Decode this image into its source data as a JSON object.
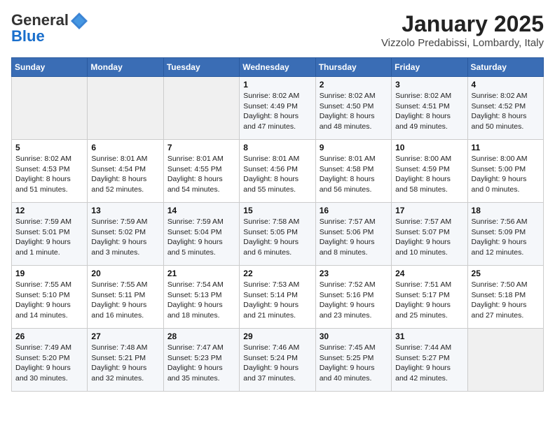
{
  "header": {
    "logo_line1": "General",
    "logo_line2": "Blue",
    "title": "January 2025",
    "subtitle": "Vizzolo Predabissi, Lombardy, Italy"
  },
  "weekdays": [
    "Sunday",
    "Monday",
    "Tuesday",
    "Wednesday",
    "Thursday",
    "Friday",
    "Saturday"
  ],
  "weeks": [
    [
      {
        "day": "",
        "info": ""
      },
      {
        "day": "",
        "info": ""
      },
      {
        "day": "",
        "info": ""
      },
      {
        "day": "1",
        "info": "Sunrise: 8:02 AM\nSunset: 4:49 PM\nDaylight: 8 hours and 47 minutes."
      },
      {
        "day": "2",
        "info": "Sunrise: 8:02 AM\nSunset: 4:50 PM\nDaylight: 8 hours and 48 minutes."
      },
      {
        "day": "3",
        "info": "Sunrise: 8:02 AM\nSunset: 4:51 PM\nDaylight: 8 hours and 49 minutes."
      },
      {
        "day": "4",
        "info": "Sunrise: 8:02 AM\nSunset: 4:52 PM\nDaylight: 8 hours and 50 minutes."
      }
    ],
    [
      {
        "day": "5",
        "info": "Sunrise: 8:02 AM\nSunset: 4:53 PM\nDaylight: 8 hours and 51 minutes."
      },
      {
        "day": "6",
        "info": "Sunrise: 8:01 AM\nSunset: 4:54 PM\nDaylight: 8 hours and 52 minutes."
      },
      {
        "day": "7",
        "info": "Sunrise: 8:01 AM\nSunset: 4:55 PM\nDaylight: 8 hours and 54 minutes."
      },
      {
        "day": "8",
        "info": "Sunrise: 8:01 AM\nSunset: 4:56 PM\nDaylight: 8 hours and 55 minutes."
      },
      {
        "day": "9",
        "info": "Sunrise: 8:01 AM\nSunset: 4:58 PM\nDaylight: 8 hours and 56 minutes."
      },
      {
        "day": "10",
        "info": "Sunrise: 8:00 AM\nSunset: 4:59 PM\nDaylight: 8 hours and 58 minutes."
      },
      {
        "day": "11",
        "info": "Sunrise: 8:00 AM\nSunset: 5:00 PM\nDaylight: 9 hours and 0 minutes."
      }
    ],
    [
      {
        "day": "12",
        "info": "Sunrise: 7:59 AM\nSunset: 5:01 PM\nDaylight: 9 hours and 1 minute."
      },
      {
        "day": "13",
        "info": "Sunrise: 7:59 AM\nSunset: 5:02 PM\nDaylight: 9 hours and 3 minutes."
      },
      {
        "day": "14",
        "info": "Sunrise: 7:59 AM\nSunset: 5:04 PM\nDaylight: 9 hours and 5 minutes."
      },
      {
        "day": "15",
        "info": "Sunrise: 7:58 AM\nSunset: 5:05 PM\nDaylight: 9 hours and 6 minutes."
      },
      {
        "day": "16",
        "info": "Sunrise: 7:57 AM\nSunset: 5:06 PM\nDaylight: 9 hours and 8 minutes."
      },
      {
        "day": "17",
        "info": "Sunrise: 7:57 AM\nSunset: 5:07 PM\nDaylight: 9 hours and 10 minutes."
      },
      {
        "day": "18",
        "info": "Sunrise: 7:56 AM\nSunset: 5:09 PM\nDaylight: 9 hours and 12 minutes."
      }
    ],
    [
      {
        "day": "19",
        "info": "Sunrise: 7:55 AM\nSunset: 5:10 PM\nDaylight: 9 hours and 14 minutes."
      },
      {
        "day": "20",
        "info": "Sunrise: 7:55 AM\nSunset: 5:11 PM\nDaylight: 9 hours and 16 minutes."
      },
      {
        "day": "21",
        "info": "Sunrise: 7:54 AM\nSunset: 5:13 PM\nDaylight: 9 hours and 18 minutes."
      },
      {
        "day": "22",
        "info": "Sunrise: 7:53 AM\nSunset: 5:14 PM\nDaylight: 9 hours and 21 minutes."
      },
      {
        "day": "23",
        "info": "Sunrise: 7:52 AM\nSunset: 5:16 PM\nDaylight: 9 hours and 23 minutes."
      },
      {
        "day": "24",
        "info": "Sunrise: 7:51 AM\nSunset: 5:17 PM\nDaylight: 9 hours and 25 minutes."
      },
      {
        "day": "25",
        "info": "Sunrise: 7:50 AM\nSunset: 5:18 PM\nDaylight: 9 hours and 27 minutes."
      }
    ],
    [
      {
        "day": "26",
        "info": "Sunrise: 7:49 AM\nSunset: 5:20 PM\nDaylight: 9 hours and 30 minutes."
      },
      {
        "day": "27",
        "info": "Sunrise: 7:48 AM\nSunset: 5:21 PM\nDaylight: 9 hours and 32 minutes."
      },
      {
        "day": "28",
        "info": "Sunrise: 7:47 AM\nSunset: 5:23 PM\nDaylight: 9 hours and 35 minutes."
      },
      {
        "day": "29",
        "info": "Sunrise: 7:46 AM\nSunset: 5:24 PM\nDaylight: 9 hours and 37 minutes."
      },
      {
        "day": "30",
        "info": "Sunrise: 7:45 AM\nSunset: 5:25 PM\nDaylight: 9 hours and 40 minutes."
      },
      {
        "day": "31",
        "info": "Sunrise: 7:44 AM\nSunset: 5:27 PM\nDaylight: 9 hours and 42 minutes."
      },
      {
        "day": "",
        "info": ""
      }
    ]
  ]
}
